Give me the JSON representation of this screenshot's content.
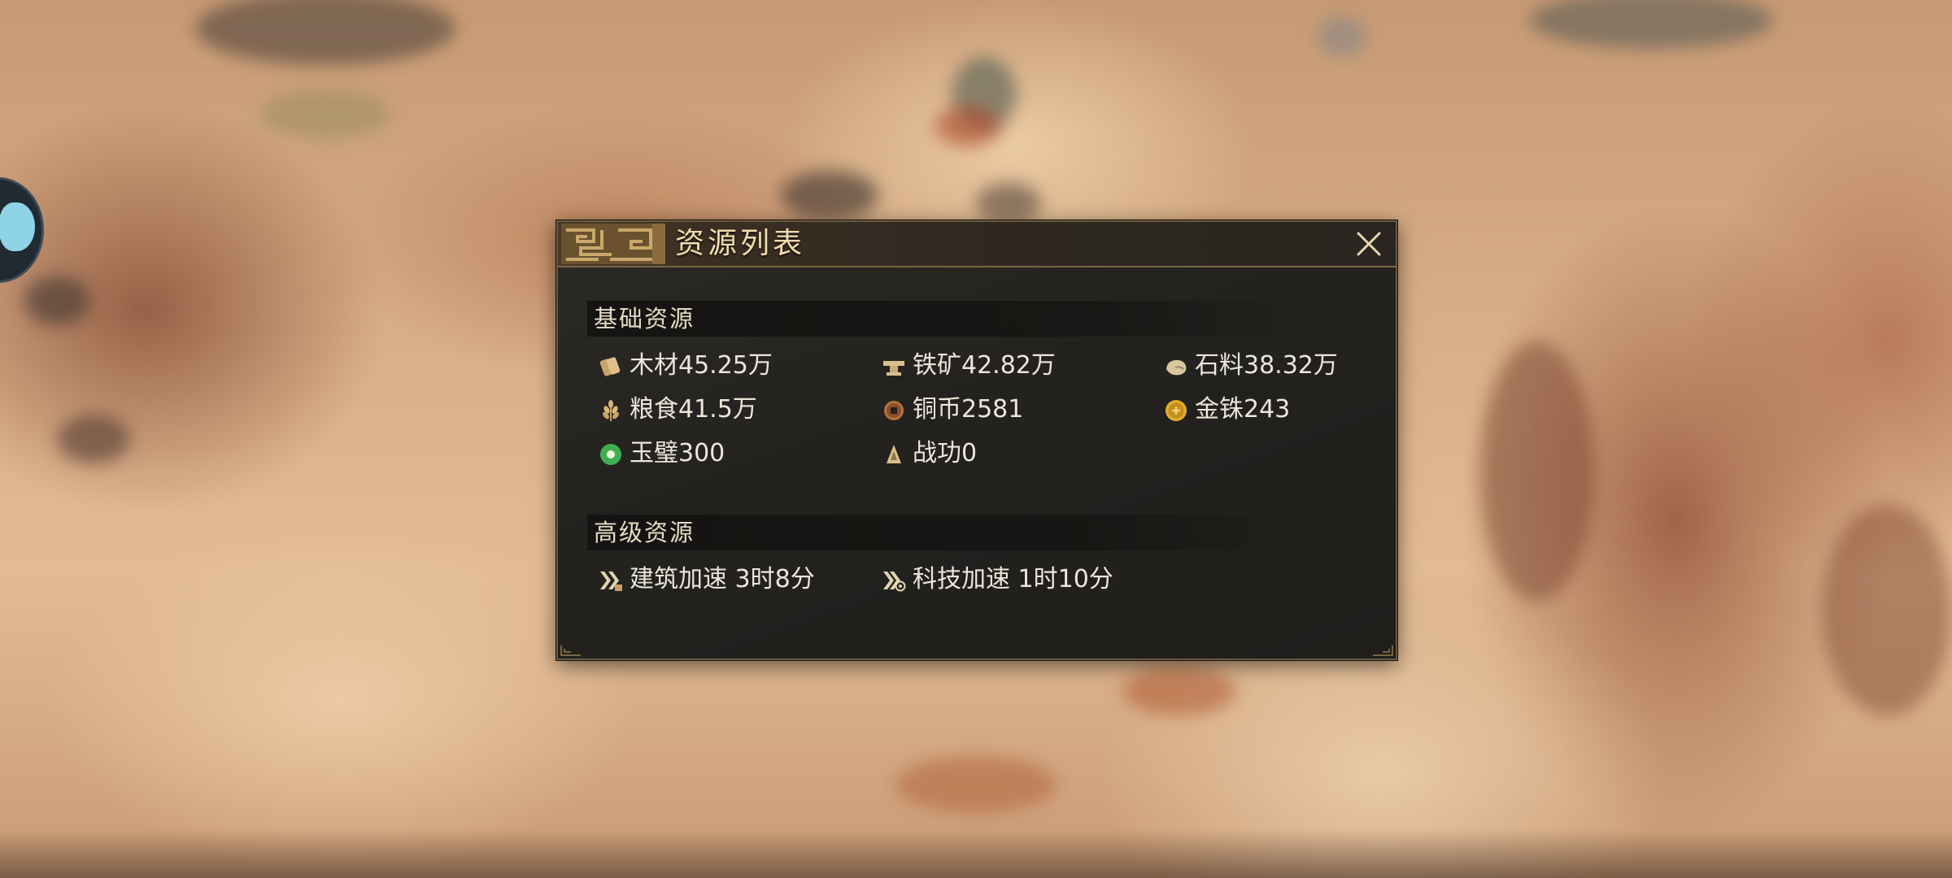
{
  "dialog": {
    "title": "资源列表",
    "close_icon": "close-x-icon"
  },
  "basic_section": {
    "header": "基础资源",
    "items": [
      {
        "icon": "wood-icon",
        "text": "木材45.25万"
      },
      {
        "icon": "iron-ore-icon",
        "text": "铁矿42.82万"
      },
      {
        "icon": "stone-icon",
        "text": "石料38.32万"
      },
      {
        "icon": "grain-icon",
        "text": "粮食41.5万"
      },
      {
        "icon": "copper-coin-icon",
        "text": "铜币2581"
      },
      {
        "icon": "gold-coin-icon",
        "text": "金铢243"
      },
      {
        "icon": "jade-disc-icon",
        "text": "玉璧300"
      },
      {
        "icon": "merit-icon",
        "text": "战功0"
      }
    ]
  },
  "advanced_section": {
    "header": "高级资源",
    "items": [
      {
        "icon": "build-speedup-icon",
        "text": "建筑加速 3时8分"
      },
      {
        "icon": "tech-speedup-icon",
        "text": "科技加速 1时10分"
      }
    ]
  },
  "colors": {
    "title_text": "#f1dcae",
    "panel_bg": "#23221f",
    "panel_border": "#6b5a3f",
    "item_text": "#ece6da"
  }
}
